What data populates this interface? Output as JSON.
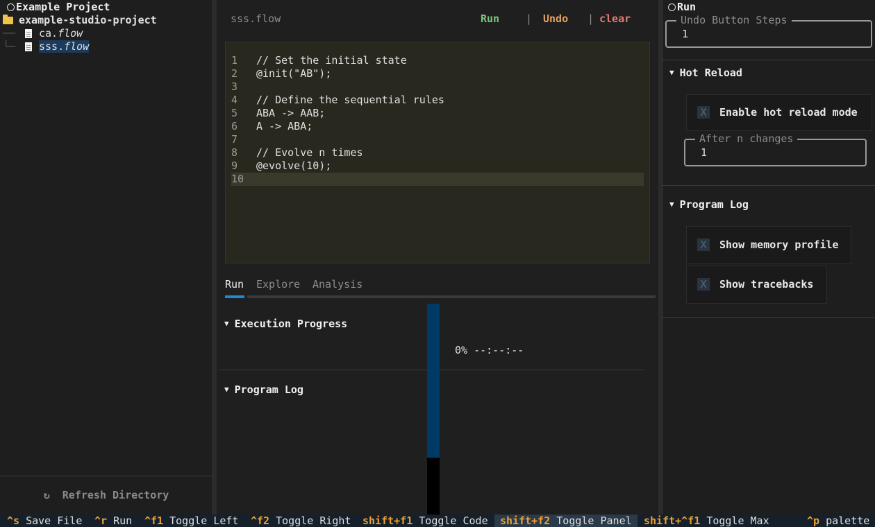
{
  "left_panel": {
    "title": "Example Project",
    "folder": "example-studio-project",
    "files": [
      {
        "base": "ca.",
        "ext": "flow"
      },
      {
        "base": "sss.",
        "ext": "flow"
      }
    ],
    "refresh_icon": "↻",
    "refresh_label": "Refresh Directory"
  },
  "editor": {
    "file_label": "sss.flow",
    "run_label": "Run",
    "undo_label": "Undo",
    "clear_label": "clear",
    "separator": "|",
    "lines": [
      {
        "n": "1",
        "text": "// Set the initial state"
      },
      {
        "n": "2",
        "text": "@init(\"AB\");"
      },
      {
        "n": "3",
        "text": ""
      },
      {
        "n": "4",
        "text": "// Define the sequential rules"
      },
      {
        "n": "5",
        "text": "ABA -> AAB;"
      },
      {
        "n": "6",
        "text": "A -> ABA;"
      },
      {
        "n": "7",
        "text": ""
      },
      {
        "n": "8",
        "text": "// Evolve n times"
      },
      {
        "n": "9",
        "text": "@evolve(10);"
      },
      {
        "n": "10",
        "text": ""
      }
    ]
  },
  "tabs": [
    "Run",
    "Explore",
    "Analysis"
  ],
  "run_panel": {
    "exec_title": "Execution Progress",
    "progress_text": "0% --:--:--",
    "log_title": "Program Log"
  },
  "right_panel": {
    "title": "Run",
    "undo_steps_legend": "Undo Button Steps",
    "undo_steps_value": "1",
    "hot_reload_title": "Hot Reload",
    "hot_reload_checkbox": "Enable hot reload mode",
    "after_changes_legend": "After n changes",
    "after_changes_value": "1",
    "program_log_title": "Program Log",
    "show_memory": "Show memory profile",
    "show_tracebacks": "Show tracebacks",
    "checkbox_mark": "X"
  },
  "footer": [
    {
      "key": "^s",
      "label": "Save File"
    },
    {
      "key": "^r",
      "label": "Run"
    },
    {
      "key": "^f1",
      "label": "Toggle Left"
    },
    {
      "key": "^f2",
      "label": "Toggle Right"
    },
    {
      "key": "shift+f1",
      "label": "Toggle Code"
    },
    {
      "key": "shift+f2",
      "label": "Toggle Panel"
    },
    {
      "key": "shift+^f1",
      "label": "Toggle Max"
    },
    {
      "key": "^p",
      "label": "palette"
    }
  ]
}
